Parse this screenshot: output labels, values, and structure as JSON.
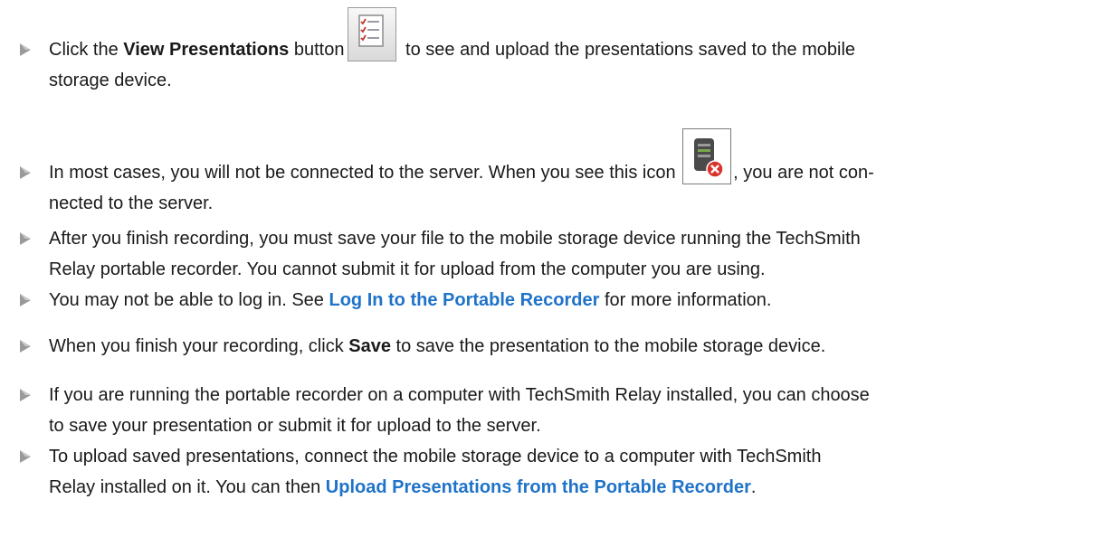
{
  "items": [
    {
      "pre": "Click the ",
      "bold": "View Presentations",
      "mid": " button",
      "post": " to see and upload the presentations saved to the mobile",
      "line2": "storage device.",
      "icon": "presentation-list-icon"
    },
    {
      "pre": "In most cases, you will not be connected to the server. When you see this icon ",
      "post": ", you are not con-",
      "line2": "nected to the server.",
      "icon": "server-disconnected-icon"
    },
    {
      "line1": "After you finish recording, you must save your file to the mobile storage device running the TechSmith",
      "line2": "Relay portable recorder. You cannot submit it for upload from the computer you are using."
    },
    {
      "pre": "You may not be able to log in. See ",
      "link": "Log In to the Portable Recorder",
      "post": " for more information."
    },
    {
      "pre": "When you finish your recording, click ",
      "bold": "Save",
      "post": " to save the presentation to the mobile storage device."
    },
    {
      "line1": "If you are running the portable recorder on a computer with TechSmith Relay installed, you can choose",
      "line2": "to save your presentation or submit it for upload to the server."
    },
    {
      "line1": "To upload saved presentations, connect the mobile storage device to a computer with TechSmith",
      "pre2": "Relay installed on it. You can then ",
      "link": "Upload Presentations from the Portable Recorder",
      "post2": "."
    }
  ],
  "colors": {
    "link": "#1f73c8",
    "bullet": "#8a8a8a"
  }
}
